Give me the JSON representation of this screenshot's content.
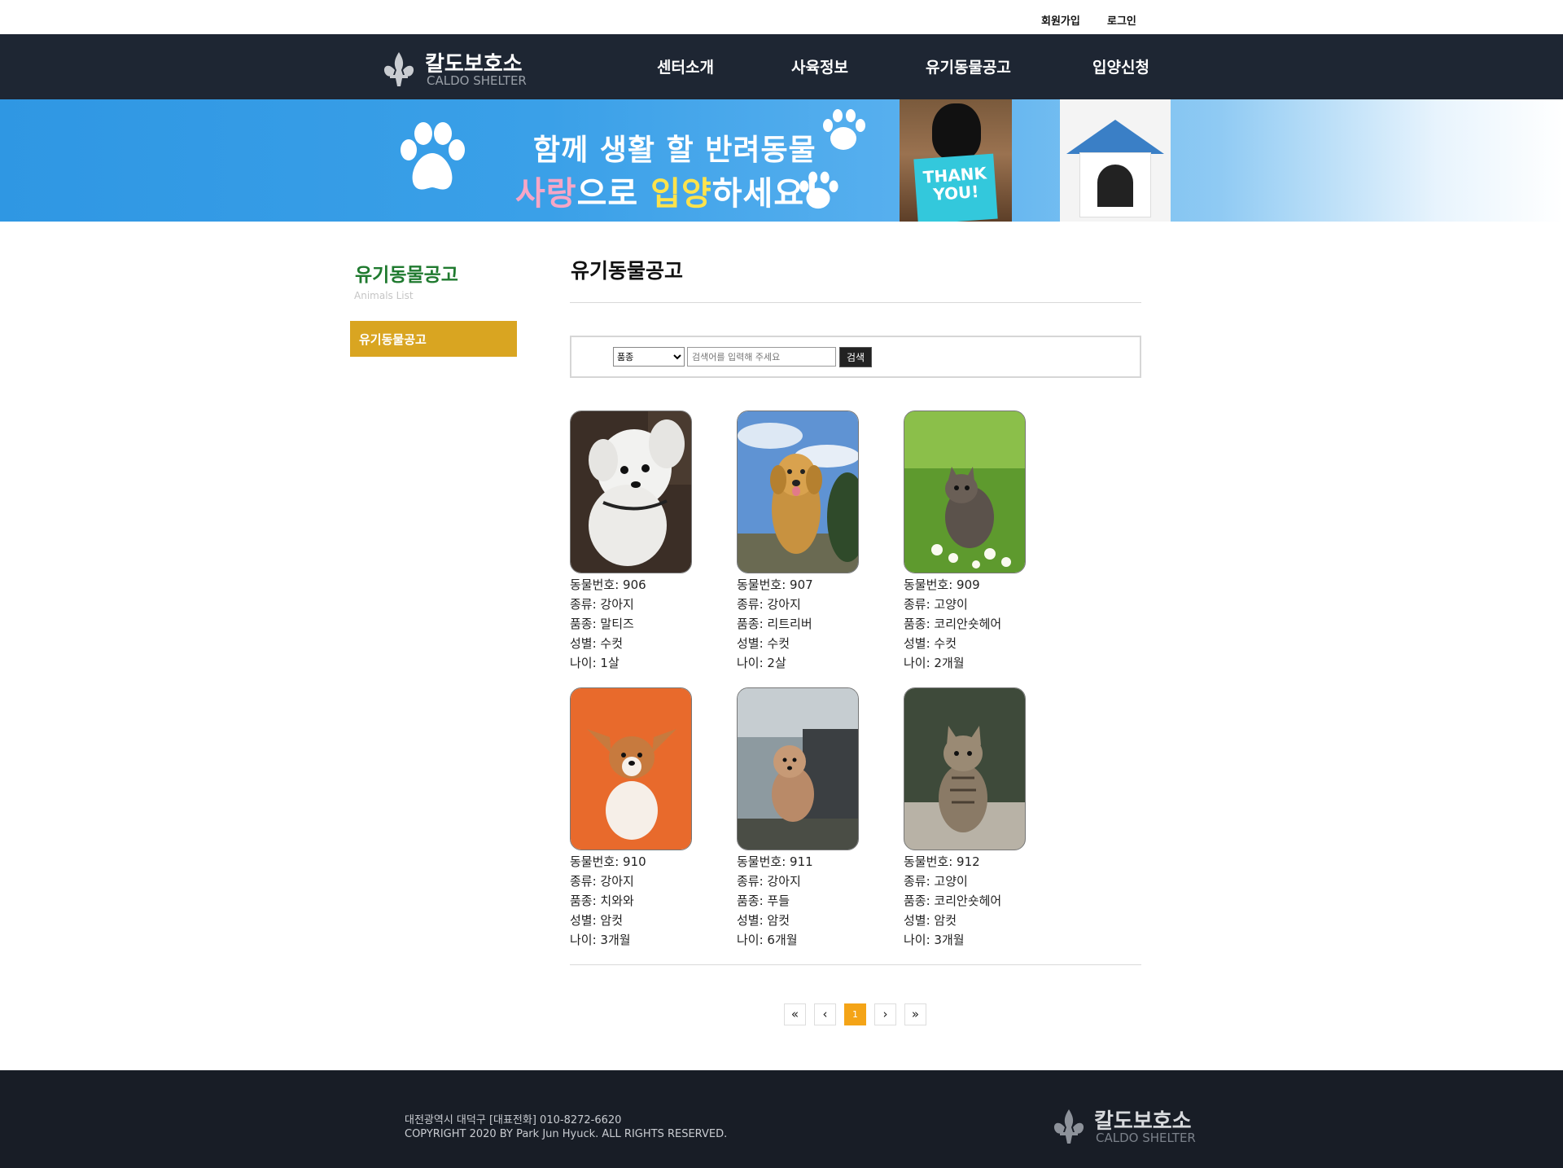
{
  "util": {
    "signup": "회원가입",
    "login": "로그인"
  },
  "logo": {
    "kr": "칼도보호소",
    "en": "CALDO SHELTER"
  },
  "nav": {
    "items": [
      {
        "label": "센터소개"
      },
      {
        "label": "사육정보"
      },
      {
        "label": "유기동물공고"
      },
      {
        "label": "입양신청"
      }
    ]
  },
  "banner": {
    "line1": "함께 생활 할 반려동물",
    "line2_a": "사랑",
    "line2_b": "으로 ",
    "line2_c": "입양",
    "line2_d": "하세요!",
    "card_text": "THANK YOU!"
  },
  "side": {
    "title": "유기동물공고",
    "subtitle": "Animals List",
    "menu_item": "유기동물공고"
  },
  "main": {
    "title": "유기동물공고"
  },
  "search": {
    "select_value": "품종",
    "placeholder": "검색어를 입력해 주세요",
    "button": "검색"
  },
  "animals": [
    {
      "no": "동물번호: 906",
      "kind": "종류: 강아지",
      "breed": "품종: 말티즈",
      "sex": "성별: 수컷",
      "age": "나이: 1살",
      "img": "white-dog-photo"
    },
    {
      "no": "동물번호: 907",
      "kind": "종류: 강아지",
      "breed": "품종: 리트리버",
      "sex": "성별: 수컷",
      "age": "나이: 2살",
      "img": "golden-retriever-photo"
    },
    {
      "no": "동물번호: 909",
      "kind": "종류: 고양이",
      "breed": "품종: 코리안숏헤어",
      "sex": "성별: 수컷",
      "age": "나이: 2개월",
      "img": "kitten-grass-photo"
    },
    {
      "no": "동물번호: 910",
      "kind": "종류: 강아지",
      "breed": "품종: 치와와",
      "sex": "성별: 암컷",
      "age": "나이: 3개월",
      "img": "puppy-orange-photo"
    },
    {
      "no": "동물번호: 911",
      "kind": "종류: 강아지",
      "breed": "품종: 푸들",
      "sex": "성별: 암컷",
      "age": "나이: 6개월",
      "img": "poodle-photo"
    },
    {
      "no": "동물번호: 912",
      "kind": "종류: 고양이",
      "breed": "품종: 코리안숏헤어",
      "sex": "성별: 암컷",
      "age": "나이: 3개월",
      "img": "tabby-kitten-photo"
    }
  ],
  "pager": {
    "first": "«",
    "prev": "‹",
    "current": "1",
    "next": "›",
    "last": "»"
  },
  "footer": {
    "address": "대전광역시 대덕구 [대표전화] 010-8272-6620",
    "copyright": "COPYRIGHT 2020 BY Park Jun Hyuck. ALL RIGHTS RESERVED.",
    "logo_kr": "칼도보호소",
    "logo_en": "CALDO SHELTER"
  },
  "colors": {
    "nav_bg": "#1e2633",
    "footer_bg": "#181d26",
    "side_accent": "#d9a521",
    "side_title": "#1f7a2f",
    "pager_active": "#f4a417"
  }
}
